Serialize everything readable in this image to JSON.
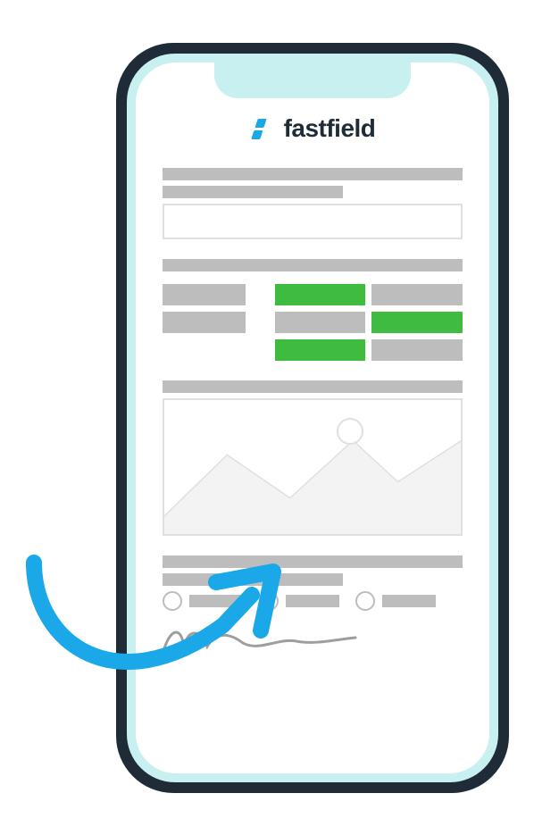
{
  "brand": {
    "name": "fastfield",
    "icon": "fastfield-logo-icon",
    "icon_color": "#1ba8e8",
    "text_color": "#1f2c38"
  },
  "colors": {
    "accent_blue": "#1ba8e8",
    "accent_green": "#3fbc3f",
    "placeholder_grey": "#bdbdbd",
    "placeholder_border": "#e0e0e0",
    "phone_frame": "#1f2c38",
    "phone_bezel": "#c9f0f0"
  },
  "form": {
    "header_bars": [
      "full",
      "w60"
    ],
    "detail_box": true,
    "grid": {
      "rows": [
        {
          "left": "short",
          "mid": "green",
          "right": "grey"
        },
        {
          "left": "short",
          "mid": "grey",
          "right": "green"
        },
        {
          "left": "empty",
          "mid": "green",
          "right": "grey"
        }
      ]
    },
    "image_placeholder": true,
    "radio_options": [
      1,
      2,
      3
    ],
    "signature": true
  },
  "arrow": {
    "color": "#1ba8e8",
    "visible": true
  }
}
